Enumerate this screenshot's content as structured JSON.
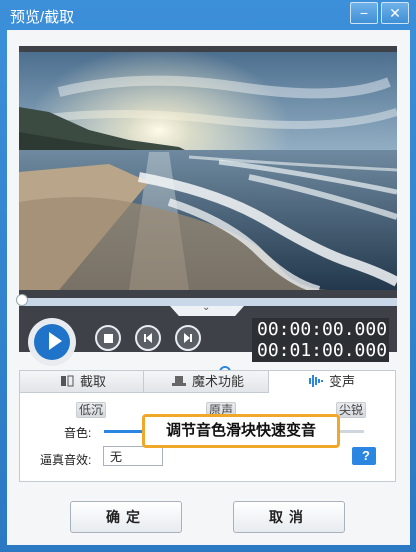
{
  "window": {
    "title": "预览/截取",
    "minimize_glyph": "−",
    "close_glyph": "✕"
  },
  "player": {
    "current_time": "00:00:00.000",
    "total_time": "00:01:00.000",
    "seek_progress": 0,
    "volume_level": 0.95,
    "collapse_glyph": "⌄"
  },
  "tabs": [
    {
      "label": "截取",
      "icon": "film-cut-icon"
    },
    {
      "label": "魔术功能",
      "icon": "magic-hat-icon"
    },
    {
      "label": "变声",
      "icon": "audio-wave-icon"
    }
  ],
  "voice": {
    "label_low": "低沉",
    "label_original": "原声",
    "label_sharp": "尖锐",
    "timbre_label": "音色:",
    "timbre_level": 0.26,
    "realistic_label": "逼真音效:",
    "realistic_value": "无",
    "callout_text": "调节音色滑块快速变音"
  },
  "buttons": {
    "ok": "确定",
    "cancel": "取消"
  },
  "colors": {
    "accent": "#2a86e0",
    "callout_border": "#f0a82a",
    "titlebar": "#2f7fc9"
  }
}
